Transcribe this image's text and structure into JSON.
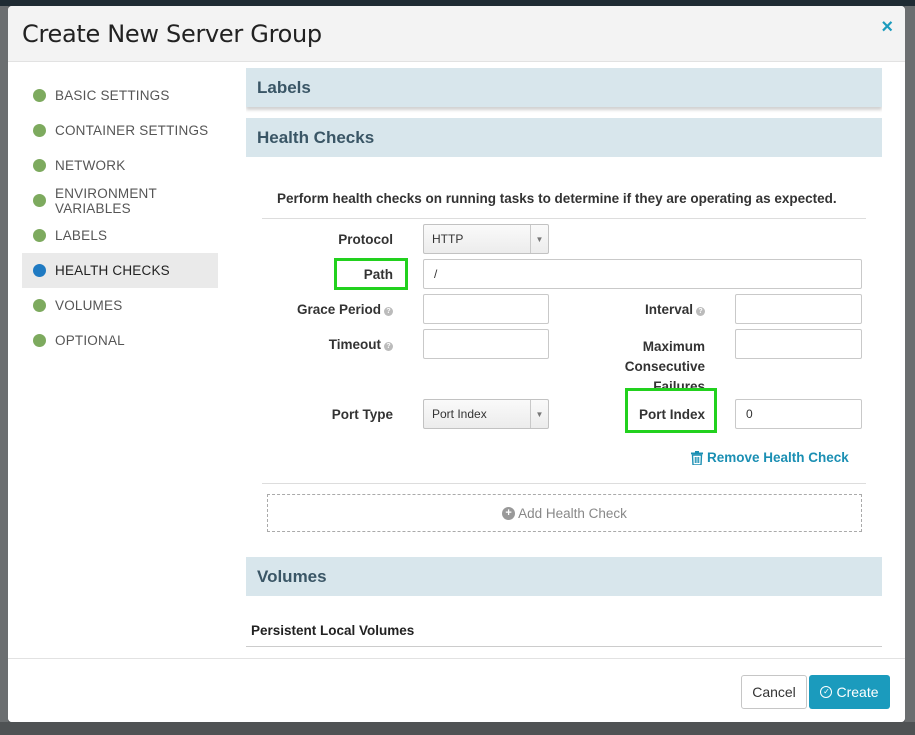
{
  "modal": {
    "title": "Create New Server Group",
    "close_icon": "×"
  },
  "sidebar": {
    "items": [
      {
        "label": "BASIC SETTINGS"
      },
      {
        "label": "CONTAINER SETTINGS"
      },
      {
        "label": "NETWORK"
      },
      {
        "label": "ENVIRONMENT VARIABLES"
      },
      {
        "label": "LABELS"
      },
      {
        "label": "HEALTH CHECKS",
        "active": true
      },
      {
        "label": "VOLUMES"
      },
      {
        "label": "OPTIONAL"
      }
    ]
  },
  "sections": {
    "labels_title": "Labels",
    "health_title": "Health Checks",
    "volumes_title": "Volumes"
  },
  "health": {
    "description": "Perform health checks on running tasks to determine if they are operating as expected.",
    "protocol": {
      "label": "Protocol",
      "value": "HTTP"
    },
    "path": {
      "label": "Path",
      "value": "/"
    },
    "grace_period": {
      "label": "Grace Period",
      "value": ""
    },
    "interval": {
      "label": "Interval",
      "value": ""
    },
    "timeout": {
      "label": "Timeout",
      "value": ""
    },
    "max_failures": {
      "label_1": "Maximum",
      "label_2": "Consecutive",
      "label_3": "Failures",
      "value": ""
    },
    "port_type": {
      "label": "Port Type",
      "value": "Port Index"
    },
    "port_index": {
      "label": "Port Index",
      "value": "0"
    },
    "remove_label": "Remove Health Check",
    "add_label": "Add Health Check"
  },
  "volumes": {
    "subheading": "Persistent Local Volumes"
  },
  "footer": {
    "cancel_label": "Cancel",
    "create_label": "Create"
  },
  "colors": {
    "accent": "#1b9bbd",
    "complete_dot": "#7daa5e",
    "active_dot": "#1f7ac2",
    "highlight": "#22d11e",
    "section_bg": "#d8e6ec"
  }
}
